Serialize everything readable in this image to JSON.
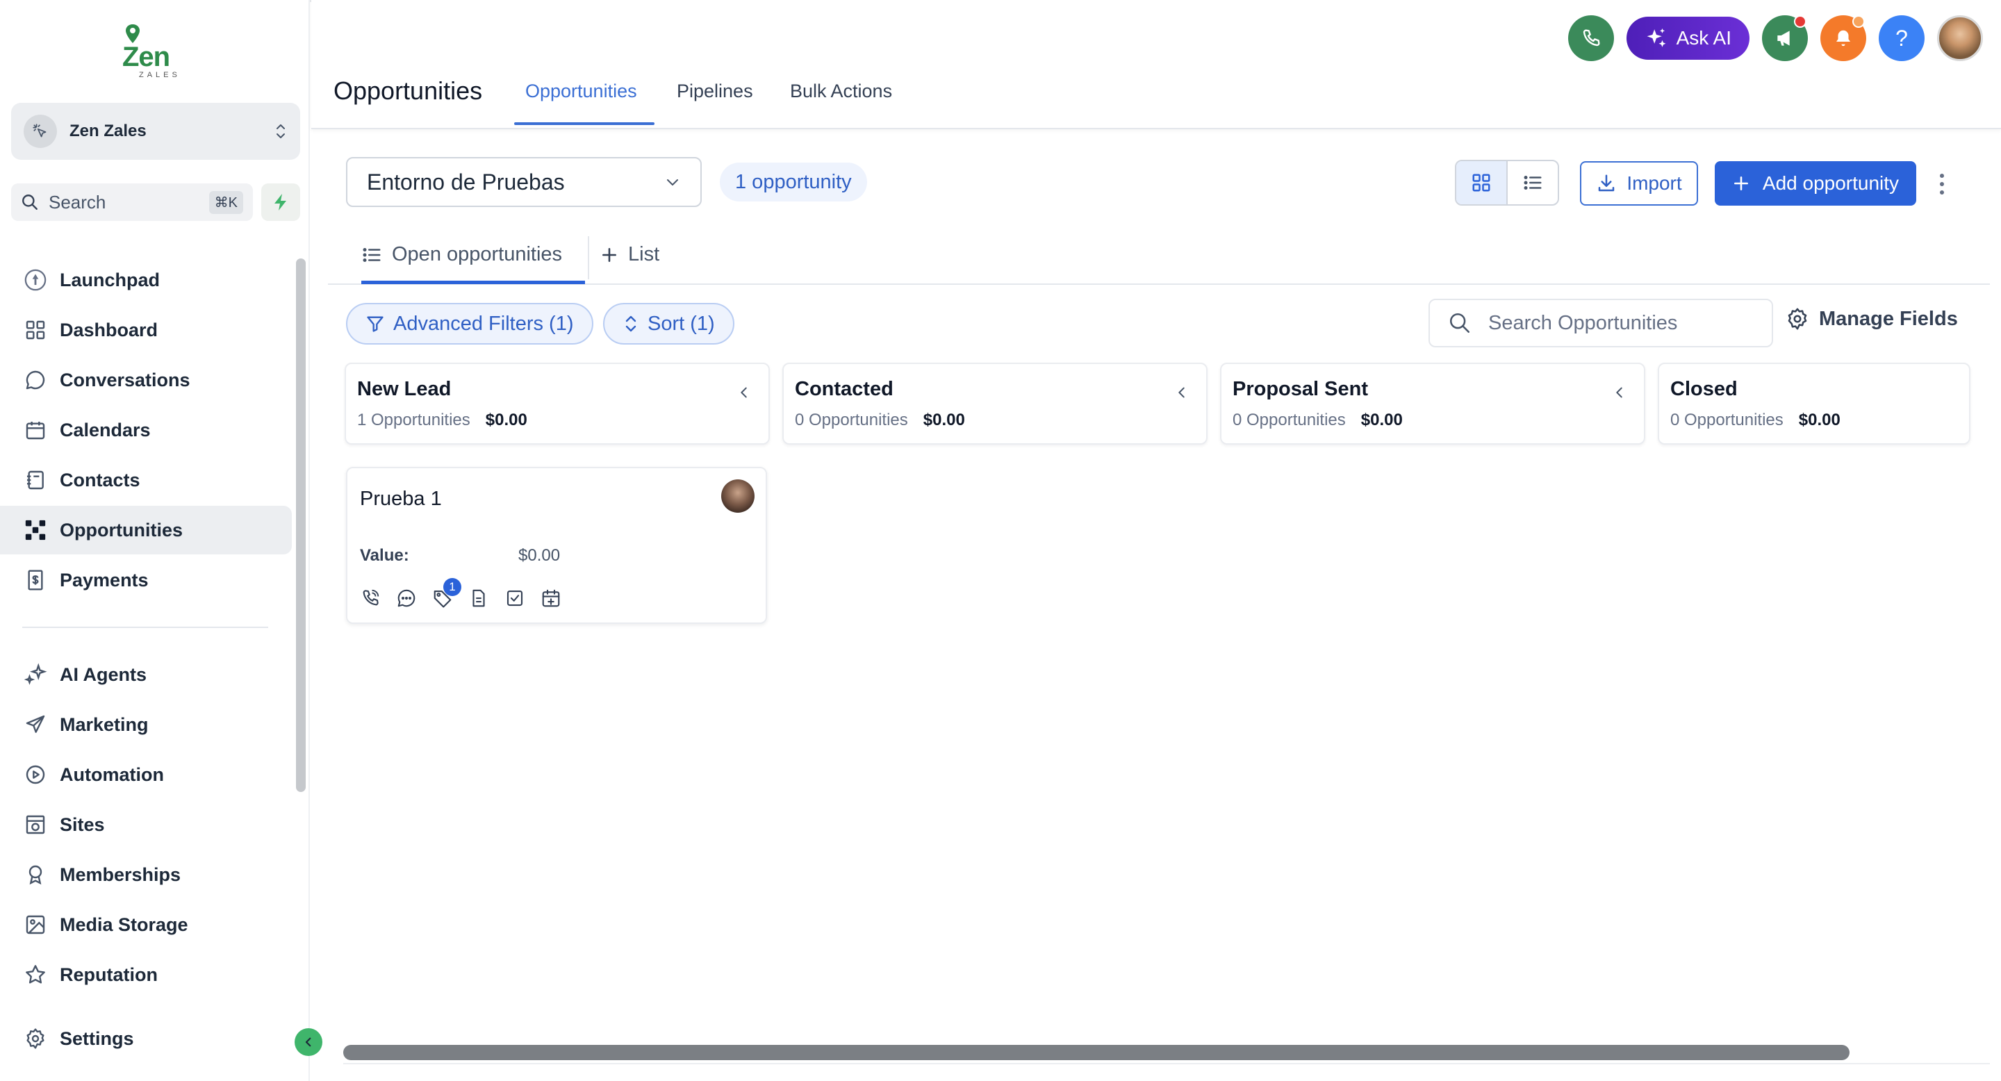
{
  "brand": {
    "logo_text": "Zen",
    "logo_sub": "ZALES"
  },
  "sidebar": {
    "account_name": "Zen Zales",
    "search_label": "Search",
    "search_shortcut": "⌘K",
    "items": [
      {
        "label": "Launchpad",
        "icon": "rocket-icon"
      },
      {
        "label": "Dashboard",
        "icon": "grid-icon"
      },
      {
        "label": "Conversations",
        "icon": "chat-icon"
      },
      {
        "label": "Calendars",
        "icon": "calendar-icon"
      },
      {
        "label": "Contacts",
        "icon": "contact-book-icon"
      },
      {
        "label": "Opportunities",
        "icon": "opportunities-icon",
        "active": true
      },
      {
        "label": "Payments",
        "icon": "payments-icon"
      }
    ],
    "items2": [
      {
        "label": "AI Agents",
        "icon": "sparkle-icon"
      },
      {
        "label": "Marketing",
        "icon": "send-icon"
      },
      {
        "label": "Automation",
        "icon": "automation-icon"
      },
      {
        "label": "Sites",
        "icon": "globe-icon"
      },
      {
        "label": "Memberships",
        "icon": "badge-icon"
      },
      {
        "label": "Media Storage",
        "icon": "image-icon"
      },
      {
        "label": "Reputation",
        "icon": "star-icon"
      }
    ],
    "settings_label": "Settings"
  },
  "header": {
    "title": "Opportunities",
    "tabs": [
      {
        "label": "Opportunities",
        "active": true
      },
      {
        "label": "Pipelines"
      },
      {
        "label": "Bulk Actions"
      }
    ],
    "ask_ai_label": "Ask AI",
    "colors": {
      "phone": "#3b8a5a",
      "megaphone": "#3b8a5a",
      "bell": "#f47a2a",
      "help": "#3b82f6",
      "ask_ai": "#5a25c7"
    }
  },
  "toolbar": {
    "pipeline_value": "Entorno de Pruebas",
    "count_badge": "1 opportunity",
    "import_label": "Import",
    "add_label": "Add opportunity"
  },
  "subtabs": {
    "open_label": "Open opportunities",
    "list_label": "List"
  },
  "filters": {
    "advanced_label": "Advanced Filters (1)",
    "sort_label": "Sort (1)",
    "search_placeholder": "Search Opportunities",
    "manage_fields_label": "Manage Fields"
  },
  "columns": [
    {
      "title": "New Lead",
      "count_text": "1 Opportunities",
      "amount": "$0.00"
    },
    {
      "title": "Contacted",
      "count_text": "0 Opportunities",
      "amount": "$0.00"
    },
    {
      "title": "Proposal Sent",
      "count_text": "0 Opportunities",
      "amount": "$0.00"
    },
    {
      "title": "Closed",
      "count_text": "0 Opportunities",
      "amount": "$0.00"
    }
  ],
  "card": {
    "title": "Prueba 1",
    "value_label": "Value:",
    "value": "$0.00",
    "tag_badge": "1"
  }
}
